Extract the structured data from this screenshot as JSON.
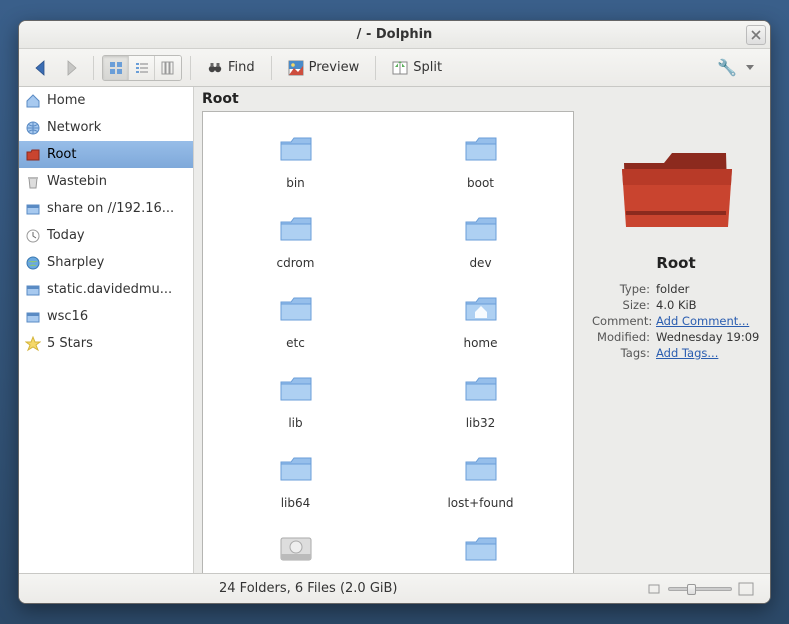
{
  "title": "/ - Dolphin",
  "toolbar": {
    "find": "Find",
    "preview": "Preview",
    "split": "Split"
  },
  "sidebar": {
    "items": [
      {
        "icon": "home",
        "label": "Home"
      },
      {
        "icon": "network",
        "label": "Network"
      },
      {
        "icon": "root",
        "label": "Root",
        "selected": true
      },
      {
        "icon": "trash",
        "label": "Wastebin"
      },
      {
        "icon": "share",
        "label": "share on //192.16..."
      },
      {
        "icon": "clock",
        "label": "Today"
      },
      {
        "icon": "globe",
        "label": "Sharpley"
      },
      {
        "icon": "share",
        "label": "static.davidedmu..."
      },
      {
        "icon": "share",
        "label": "wsc16"
      },
      {
        "icon": "star",
        "label": "5 Stars"
      }
    ]
  },
  "main": {
    "path": "Root",
    "folders": [
      {
        "label": "bin",
        "kind": "folder"
      },
      {
        "label": "boot",
        "kind": "folder"
      },
      {
        "label": "cdrom",
        "kind": "folder"
      },
      {
        "label": "dev",
        "kind": "folder"
      },
      {
        "label": "etc",
        "kind": "folder"
      },
      {
        "label": "home",
        "kind": "home"
      },
      {
        "label": "lib",
        "kind": "folder"
      },
      {
        "label": "lib32",
        "kind": "folder"
      },
      {
        "label": "lib64",
        "kind": "folder"
      },
      {
        "label": "lost+found",
        "kind": "folder"
      },
      {
        "label": "",
        "kind": "drive"
      },
      {
        "label": "",
        "kind": "folder"
      }
    ]
  },
  "info": {
    "name": "Root",
    "type_k": "Type:",
    "type_v": "folder",
    "size_k": "Size:",
    "size_v": "4.0 KiB",
    "comment_k": "Comment:",
    "comment_v": "Add Comment...",
    "modified_k": "Modified:",
    "modified_v": "Wednesday 19:09",
    "tags_k": "Tags:",
    "tags_v": "Add Tags..."
  },
  "status": {
    "text": "24 Folders, 6 Files (2.0 GiB)"
  }
}
